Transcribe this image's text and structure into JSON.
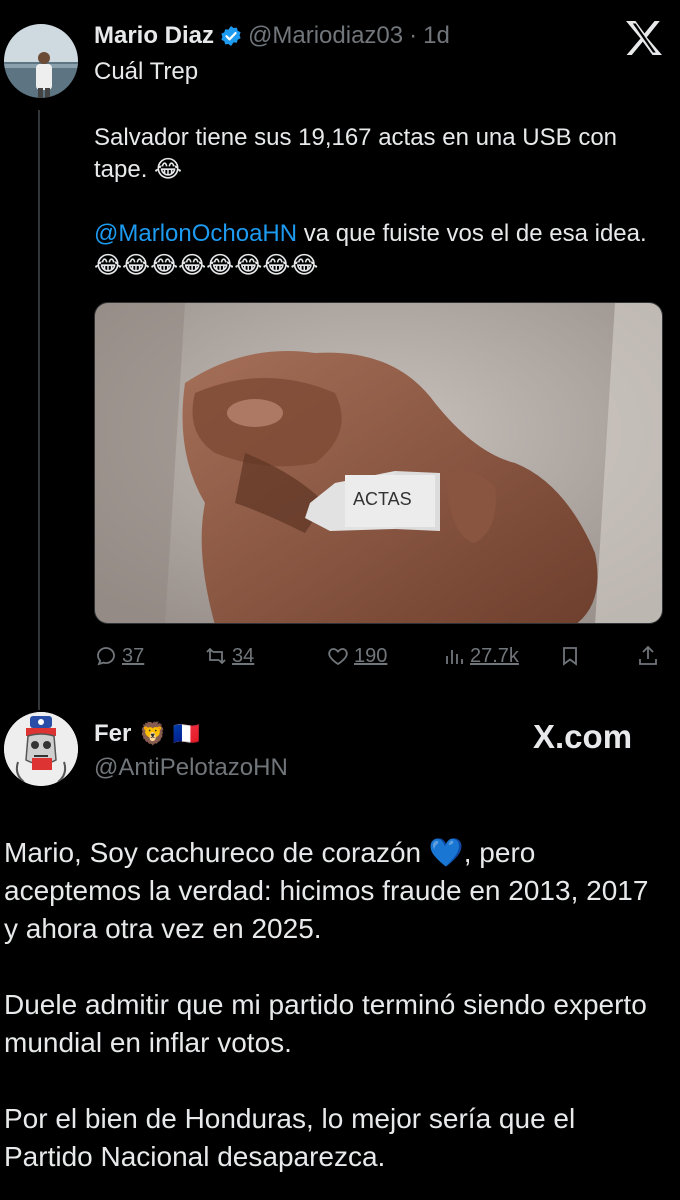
{
  "tweet1": {
    "author_name": "Mario Diaz",
    "handle": "@Mariodiaz03",
    "separator": "·",
    "time": "1d",
    "reply_text": "Cuál Trep",
    "body_line1": "Salvador tiene sus 19,167 actas en una USB con tape. 😂",
    "mention": "@MarlonOchoaHN",
    "body_line2_rest": " va que fuiste vos el de esa idea. 😂😂😂😂😂😂😂😂",
    "media_caption": "ACTAS",
    "stats": {
      "replies": "37",
      "reposts": "34",
      "likes": "190",
      "views": "27.7k"
    }
  },
  "tweet2": {
    "author_name": "Fer",
    "author_emojis": "🦁 🇫🇷",
    "handle": "@AntiPelotazoHN",
    "watermark": "X.com",
    "paragraphs": [
      "Mario, Soy cachureco de corazón 💙, pero aceptemos la verdad: hicimos fraude en 2013, 2017 y ahora otra vez en 2025.",
      "Duele admitir que mi partido terminó siendo experto mundial en inflar votos.",
      "Por el bien de Honduras, lo mejor sería que el Partido Nacional desaparezca."
    ]
  },
  "colors": {
    "background": "#000000",
    "text": "#e7e9ea",
    "muted": "#71767b",
    "link": "#1d9bf0",
    "verified": "#1d9bf0"
  },
  "icons": [
    "verified-badge-icon",
    "x-logo-icon",
    "reply-icon",
    "repost-icon",
    "like-icon",
    "views-icon",
    "bookmark-icon",
    "share-icon"
  ]
}
